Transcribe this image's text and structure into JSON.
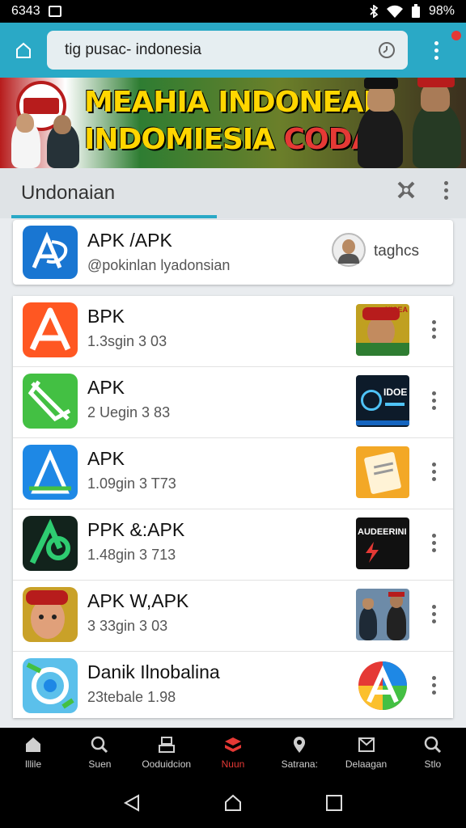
{
  "status_bar": {
    "time": "6343",
    "battery": "98%"
  },
  "toolbar": {
    "url": "tig pusac- indonesia"
  },
  "banner": {
    "line1": "MEAHIA INDONEAN",
    "line2a": "INDOMIESIA",
    "line2b": "CODA!"
  },
  "tab_header": {
    "title": "Undonaian"
  },
  "top_card": {
    "name": "APK /APK",
    "handle": "@pokinlan lyadonsian",
    "tag": "taghcs"
  },
  "apps": [
    {
      "name": "BPK",
      "meta": "1.3sgin 3 03"
    },
    {
      "name": "APK",
      "meta": "2 Uegin 3 83"
    },
    {
      "name": "APK",
      "meta": "1.09gin 3 T73"
    },
    {
      "name": "PPK &:APK",
      "meta": "1.48gin 3 713"
    },
    {
      "name": "APK W,APK",
      "meta": "3 33gin 3 03"
    },
    {
      "name": "Danik Ilnobalina",
      "meta": "23tebale 1.98"
    }
  ],
  "thumb_text": {
    "t1": "NICEA",
    "t2": "IDOE",
    "t4": "AUDEERINI"
  },
  "bottom_nav": [
    {
      "label": "lllile",
      "icon": "home-icon"
    },
    {
      "label": "Suen",
      "icon": "search-icon"
    },
    {
      "label": "Ooduidcion",
      "icon": "stack-icon"
    },
    {
      "label": "Nuun",
      "icon": "stack-red-icon"
    },
    {
      "label": "Satrana:",
      "icon": "pin-icon"
    },
    {
      "label": "Delaagan",
      "icon": "message-icon"
    },
    {
      "label": "Stlo",
      "icon": "search-icon"
    }
  ],
  "colors": {
    "accent": "#2aa9c6",
    "active_nav": "#e53935"
  }
}
